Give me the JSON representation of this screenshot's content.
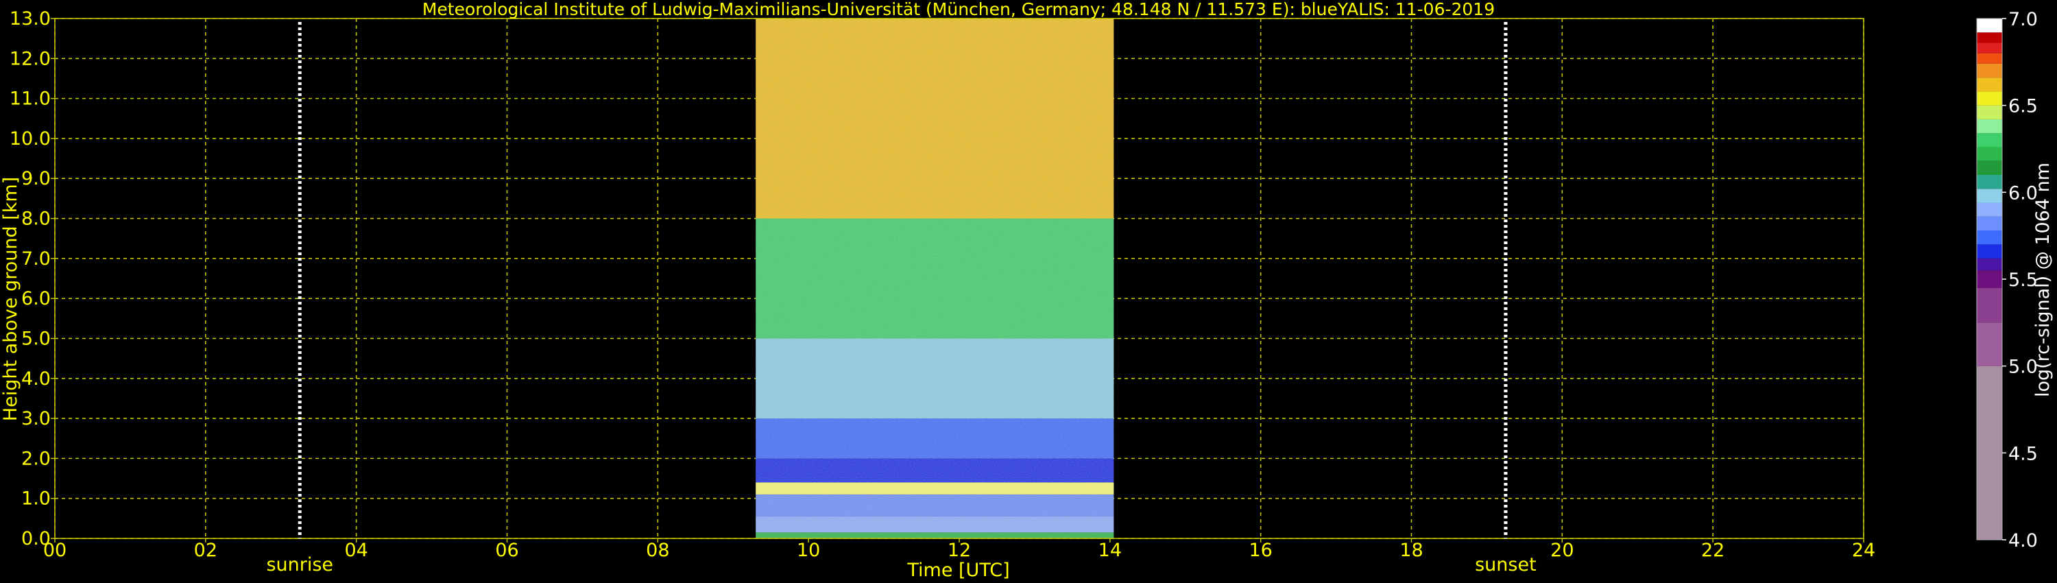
{
  "chart_data": {
    "type": "heatmap",
    "title": "Meteorological Institute of Ludwig-Maximilians-Universität (München, Germany; 48.148 N / 11.573 E):    blueYALIS: 11-06-2019",
    "xlabel": "Time [UTC]",
    "ylabel": "Height above ground [km]",
    "xlim": [
      0,
      24
    ],
    "ylim": [
      0,
      13
    ],
    "x_ticks": [
      "00",
      "02",
      "04",
      "06",
      "08",
      "10",
      "12",
      "14",
      "16",
      "18",
      "20",
      "22",
      "24"
    ],
    "y_ticks": [
      "0.0",
      "1.0",
      "2.0",
      "3.0",
      "4.0",
      "5.0",
      "6.0",
      "7.0",
      "8.0",
      "9.0",
      "10.0",
      "11.0",
      "12.0",
      "13.0"
    ],
    "grid": true,
    "measurement_period": [
      9.3,
      14.05
    ],
    "annotations": [
      {
        "label": "sunrise",
        "x": 3.25
      },
      {
        "label": "sunset",
        "x": 19.25
      }
    ],
    "colorbar": {
      "label": "log(rc-signal) @ 1064 nm",
      "ticks": [
        "4.0",
        "4.5",
        "5.0",
        "5.5",
        "6.0",
        "6.5",
        "7.0"
      ],
      "range": [
        4.0,
        7.0
      ],
      "levels": [
        {
          "from": 4.0,
          "to": 5.0,
          "color": "#a98fa2"
        },
        {
          "from": 5.0,
          "to": 5.25,
          "color": "#9c5f9c"
        },
        {
          "from": 5.25,
          "to": 5.45,
          "color": "#8a3f8f"
        },
        {
          "from": 5.45,
          "to": 5.55,
          "color": "#6e0f7e"
        },
        {
          "from": 5.55,
          "to": 5.62,
          "color": "#4b16a8"
        },
        {
          "from": 5.62,
          "to": 5.7,
          "color": "#1c2ee8"
        },
        {
          "from": 5.7,
          "to": 5.78,
          "color": "#3f6cff"
        },
        {
          "from": 5.78,
          "to": 5.86,
          "color": "#6e8fff"
        },
        {
          "from": 5.86,
          "to": 5.94,
          "color": "#8eb0ff"
        },
        {
          "from": 5.94,
          "to": 6.02,
          "color": "#8ed0e8"
        },
        {
          "from": 6.02,
          "to": 6.1,
          "color": "#2aa890"
        },
        {
          "from": 6.1,
          "to": 6.18,
          "color": "#229a3a"
        },
        {
          "from": 6.18,
          "to": 6.26,
          "color": "#2cb84a"
        },
        {
          "from": 6.26,
          "to": 6.34,
          "color": "#3ed06a"
        },
        {
          "from": 6.34,
          "to": 6.42,
          "color": "#8ef09a"
        },
        {
          "from": 6.42,
          "to": 6.5,
          "color": "#c8f060"
        },
        {
          "from": 6.5,
          "to": 6.58,
          "color": "#f0f020"
        },
        {
          "from": 6.58,
          "to": 6.66,
          "color": "#f0c020"
        },
        {
          "from": 6.66,
          "to": 6.74,
          "color": "#f09020"
        },
        {
          "from": 6.74,
          "to": 6.8,
          "color": "#f05010"
        },
        {
          "from": 6.8,
          "to": 6.86,
          "color": "#e02020"
        },
        {
          "from": 6.86,
          "to": 6.92,
          "color": "#c00000"
        },
        {
          "from": 6.92,
          "to": 7.0,
          "color": "#ffffff"
        }
      ]
    },
    "colors": {
      "background": "#000000",
      "text": "#ffff00",
      "grid": "#c8c800",
      "colorbar_text": "#ffffff",
      "marker": "#ffffff"
    }
  }
}
